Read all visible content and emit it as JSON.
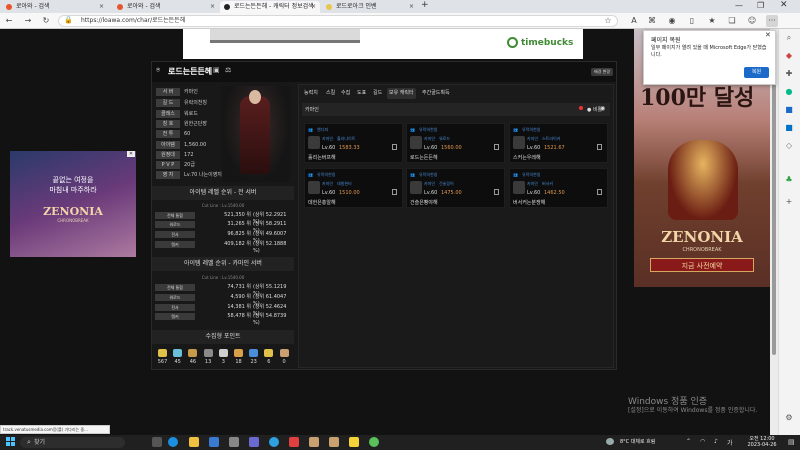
{
  "browser": {
    "tabs": [
      {
        "label": "로아와 - 검색",
        "active": false
      },
      {
        "label": "로아와 - 검색",
        "active": false
      },
      {
        "label": "로드는든든헤 - 캐릭터 정보검색",
        "active": true
      },
      {
        "label": "로드로아크 인벤",
        "active": false
      }
    ],
    "url": "https://loawa.com/char/로드는든든헤",
    "new_tab": "+"
  },
  "timebucks": "timebucks",
  "character": {
    "name": "로드는든든헤",
    "settings_btn": "배경 변경",
    "info": [
      {
        "key": "서 버",
        "value": "카마인"
      },
      {
        "key": "길 드",
        "value": "유락의천칭"
      },
      {
        "key": "클래스",
        "value": "워로드"
      },
      {
        "key": "칭 호",
        "value": "원한근단장"
      },
      {
        "key": "전 투",
        "value": "60"
      },
      {
        "key": "아이템",
        "value": "1,560.00"
      },
      {
        "key": "원정대",
        "value": "172"
      },
      {
        "key": "P V P",
        "value": "20급"
      },
      {
        "key": "영 지",
        "value": "Lv.70 나는이영지"
      }
    ]
  },
  "rank_all": {
    "title": "아이템 레벨 순위 - 전 서버",
    "cutline": "Cut Line : Lv.1540.00",
    "rows": [
      {
        "k": "전체 통합",
        "n": "521,350 위",
        "p": "(상위 52.2921 %)"
      },
      {
        "k": "워로드",
        "n": "31,265 위",
        "p": "(상위 58.2911 %)"
      },
      {
        "k": "전사",
        "n": "96,825 위",
        "p": "(상위 49.6007 %)"
      },
      {
        "k": "탱커",
        "n": "409,182 위",
        "p": "(상위 52.1888 %)"
      }
    ]
  },
  "rank_server": {
    "title": "아이템 레벨 순위 - 카마인 서버",
    "cutline": "Cut Line : Lv.1540.00",
    "rows": [
      {
        "k": "전체 통합",
        "n": "74,731 위",
        "p": "(상위 55.1219 %)"
      },
      {
        "k": "워로드",
        "n": "4,590 위",
        "p": "(상위 61.4047 %)"
      },
      {
        "k": "전사",
        "n": "14,381 위",
        "p": "(상위 52.4624 %)"
      },
      {
        "k": "탱커",
        "n": "58,478 위",
        "p": "(상위 54.8739 %)"
      }
    ]
  },
  "collection": {
    "title": "수집형 포인트",
    "items": [
      {
        "value": "567",
        "color": "#e0c24a"
      },
      {
        "value": "45",
        "color": "#6ac0d8"
      },
      {
        "value": "46",
        "color": "#c79a4a"
      },
      {
        "value": "13",
        "color": "#8a8a8a"
      },
      {
        "value": "3",
        "color": "#cfcfcf"
      },
      {
        "value": "18",
        "color": "#d8a048"
      },
      {
        "value": "23",
        "color": "#4a8ed9"
      },
      {
        "value": "6",
        "color": "#e0c24a"
      },
      {
        "value": "0",
        "color": "#c9a070"
      }
    ]
  },
  "panel": {
    "tabs": [
      "능력치",
      "스킬",
      "수집",
      "도표",
      "길드",
      "보유 캐릭터",
      "주간골드획득"
    ],
    "active_tab": 5,
    "server": "카마인",
    "compare": "● 비활",
    "chars": [
      {
        "guild": "앤디파",
        "server": "카마인",
        "cls": "홀리나이트",
        "lv": "Lv.60",
        "il": "1583.33",
        "name": "홀리는버프해"
      },
      {
        "guild": "유락의천칭",
        "server": "카마인",
        "cls": "워로드",
        "lv": "Lv.60",
        "il": "1560.00",
        "name": "로드는든든헤"
      },
      {
        "guild": "유락의천칭",
        "server": "카마인",
        "cls": "스트라이커",
        "lv": "Lv.60",
        "il": "1521.67",
        "name": "스커는우레해"
      },
      {
        "guild": "유락의천칭",
        "server": "카마인",
        "cls": "데빌헌터",
        "lv": "Lv.60",
        "il": "1510.00",
        "name": "데헌은총알해"
      },
      {
        "guild": "유락의천칭",
        "server": "카마인",
        "cls": "건슬링어",
        "lv": "Lv.60",
        "il": "1475.00",
        "name": "건슬은빵야해"
      },
      {
        "guild": "유락의천칭",
        "server": "카마인",
        "cls": "버서커",
        "lv": "Lv.60",
        "il": "1462.50",
        "name": "버서커는분쟁해"
      }
    ]
  },
  "ads": {
    "left_text": "끝없는 여정을\n마침내 마주하라",
    "left_logo": "ZENONIA",
    "left_sub": "CHRONOBREAK",
    "right_big": "100만 달성",
    "right_logo": "ZENONIA",
    "right_sub": "CHRONOBREAK",
    "right_btn": "지금 사전예약"
  },
  "popup": {
    "title": "페이지 복원",
    "body": "일부 페이지가 열려 있을 때 Microsoft Edge가 닫혔습니다.",
    "button": "복원"
  },
  "watermark": {
    "line1": "Windows 정품 인증",
    "line2": "[설정]으로 이동하여 Windows를 정품 인증합니다."
  },
  "statusbar": "track.venatusmedia.com응(를) 기다리는 중...",
  "taskbar": {
    "search": "찾기",
    "weather": "8°C  대체로 흐림",
    "time": "오전 12:00",
    "date": "2023-04-26"
  }
}
